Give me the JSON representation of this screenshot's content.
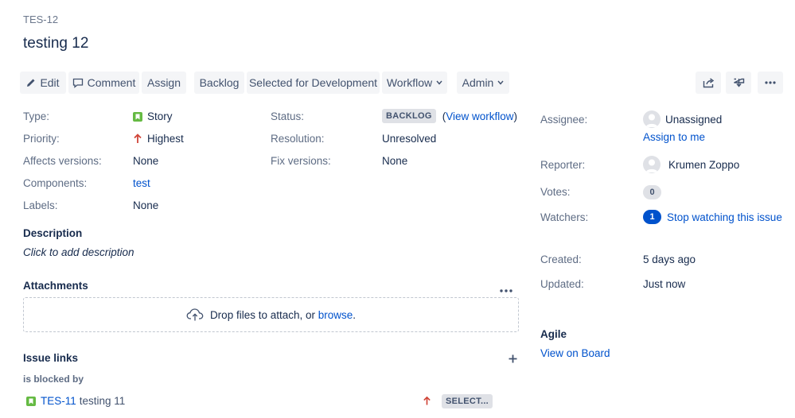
{
  "issue": {
    "key": "TES-12",
    "title": "testing 12"
  },
  "toolbar": {
    "edit": "Edit",
    "comment": "Comment",
    "assign": "Assign",
    "backlog": "Backlog",
    "selected_dev": "Selected for Development",
    "workflow": "Workflow",
    "admin": "Admin"
  },
  "details": {
    "type_label": "Type:",
    "type_value": "Story",
    "priority_label": "Priority:",
    "priority_value": "Highest",
    "affects_label": "Affects versions:",
    "affects_value": "None",
    "components_label": "Components:",
    "components_value": "test",
    "labels_label": "Labels:",
    "labels_value": "None",
    "status_label": "Status:",
    "status_value": "BACKLOG",
    "view_workflow_open": "(",
    "view_workflow": "View workflow",
    "view_workflow_close": ")",
    "resolution_label": "Resolution:",
    "resolution_value": "Unresolved",
    "fix_label": "Fix versions:",
    "fix_value": "None"
  },
  "description": {
    "heading": "Description",
    "placeholder": "Click to add description"
  },
  "attachments": {
    "heading": "Attachments",
    "drop_text": "Drop files to attach, or ",
    "browse": "browse",
    "period": "."
  },
  "issue_links": {
    "heading": "Issue links",
    "relation": "is blocked by",
    "items": [
      {
        "key": "TES-11",
        "summary": "testing 11",
        "status": "SELECT..."
      }
    ]
  },
  "people": {
    "assignee_label": "Assignee:",
    "assignee_value": "Unassigned",
    "assign_to_me": "Assign to me",
    "reporter_label": "Reporter:",
    "reporter_value": "Krumen Zoppo",
    "votes_label": "Votes:",
    "votes_value": "0",
    "watchers_label": "Watchers:",
    "watchers_value": "1",
    "stop_watching": "Stop watching this issue"
  },
  "dates": {
    "created_label": "Created:",
    "created_value": "5 days ago",
    "updated_label": "Updated:",
    "updated_value": "Just now"
  },
  "agile": {
    "heading": "Agile",
    "view_on_board": "View on Board"
  },
  "colors": {
    "link": "#0052cc",
    "story": "#65ba43",
    "priority": "#d04437",
    "badge_blue": "#0052cc"
  }
}
